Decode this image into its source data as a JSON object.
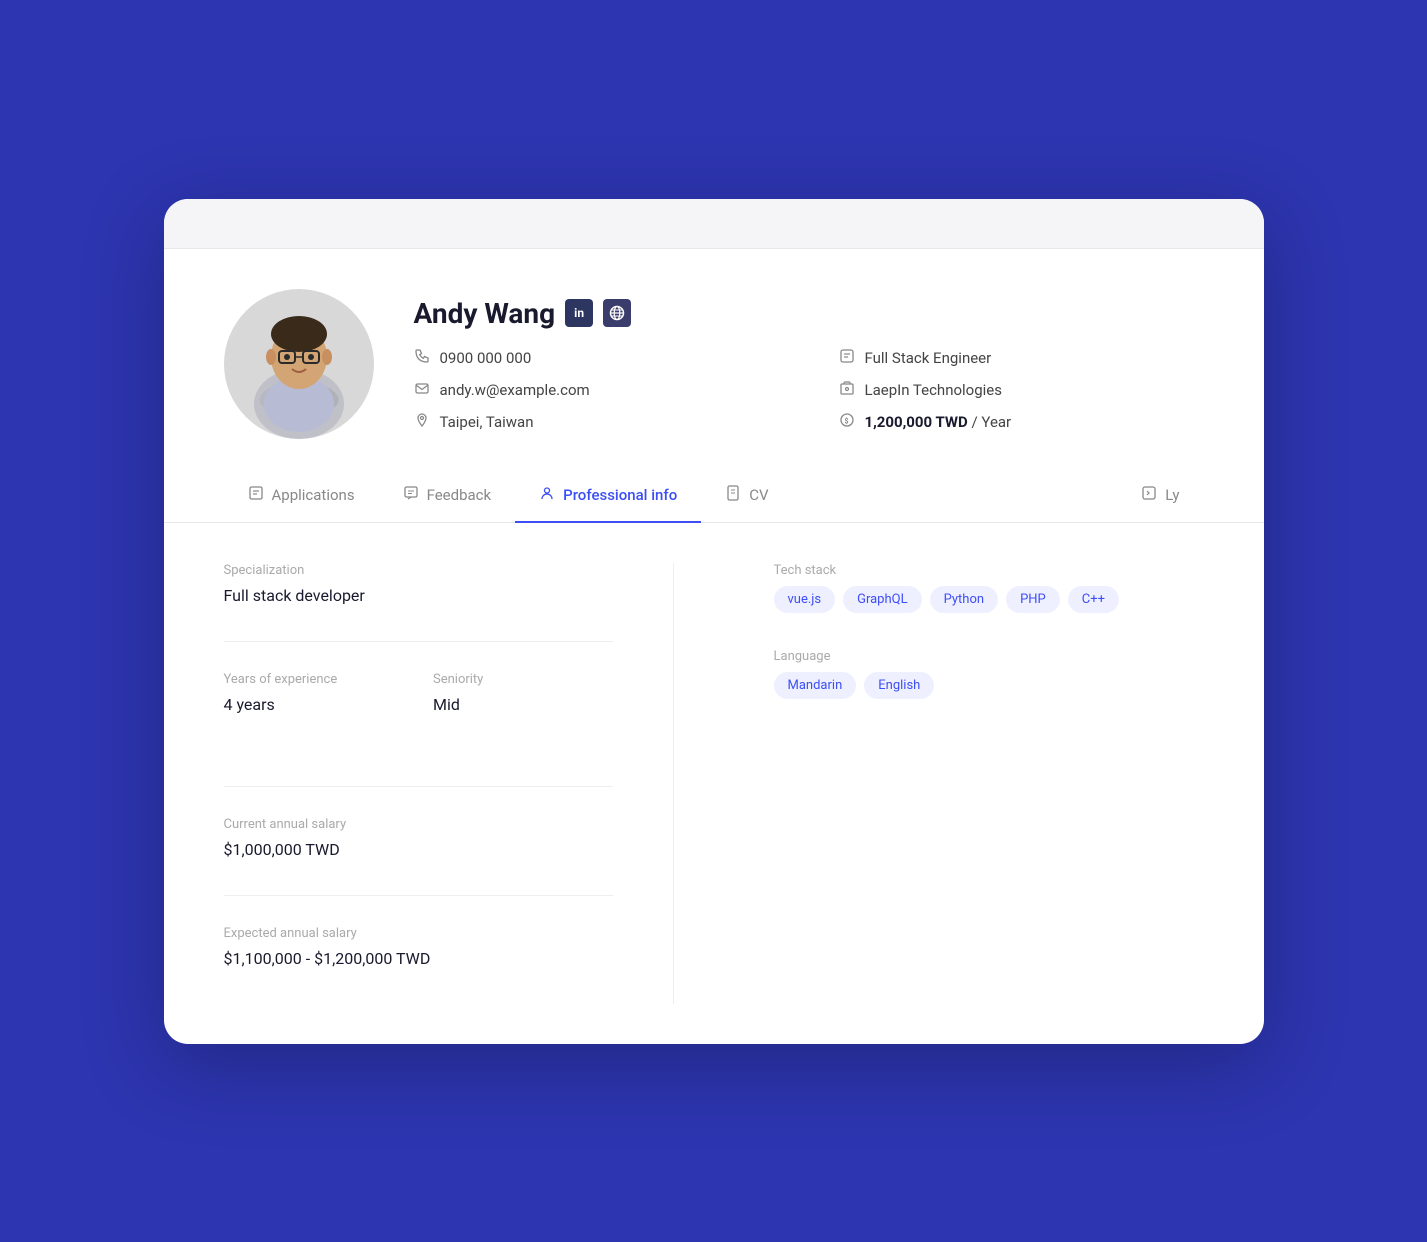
{
  "profile": {
    "name": "Andy Wang",
    "phone": "0900 000 000",
    "email": "andy.w@example.com",
    "location": "Taipei, Taiwan",
    "title": "Full Stack Engineer",
    "company": "LaepIn Technologies",
    "salary": "1,200,000 TWD",
    "salary_period": "Year",
    "linkedin_label": "in",
    "website_label": "🌐"
  },
  "tabs": [
    {
      "id": "applications",
      "label": "Applications",
      "active": false
    },
    {
      "id": "feedback",
      "label": "Feedback",
      "active": false
    },
    {
      "id": "professional-info",
      "label": "Professional info",
      "active": true
    },
    {
      "id": "cv",
      "label": "CV",
      "active": false
    },
    {
      "id": "ly",
      "label": "Ly",
      "active": false
    }
  ],
  "professional_info": {
    "specialization_label": "Specialization",
    "specialization_value": "Full stack developer",
    "years_label": "Years of experience",
    "years_value": "4 years",
    "seniority_label": "Seniority",
    "seniority_value": "Mid",
    "current_salary_label": "Current annual salary",
    "current_salary_value": "$1,000,000 TWD",
    "expected_salary_label": "Expected annual salary",
    "expected_salary_value": "$1,100,000 - $1,200,000 TWD",
    "tech_stack_label": "Tech stack",
    "tech_stack": [
      "vue.js",
      "GraphQL",
      "Python",
      "PHP",
      "C++"
    ],
    "language_label": "Language",
    "languages": [
      "Mandarin",
      "English"
    ]
  },
  "colors": {
    "active_tab": "#3d4ef5",
    "tag_bg": "#eef0ff",
    "tag_text": "#3d4ef5"
  }
}
